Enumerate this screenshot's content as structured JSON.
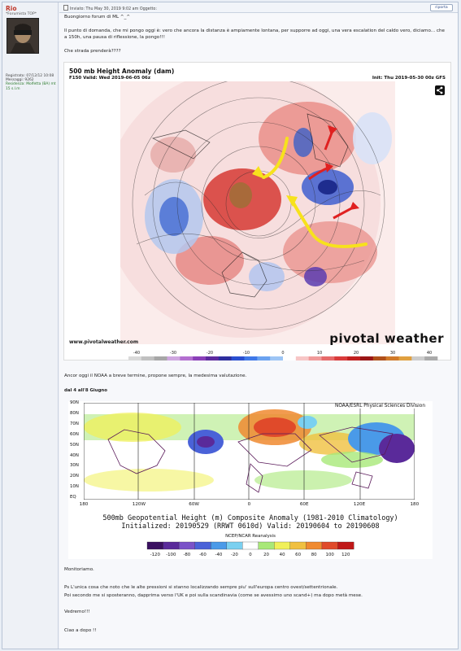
{
  "user": {
    "name": "Rio",
    "rank": "*Forumista TOP*",
    "registered": "Registrato: 07/12/12 10:08",
    "messages": "Messaggi: 9262",
    "residence": "Residenza: Molfetta (BA) mt 15 s.l.m"
  },
  "post": {
    "meta": "Inviato: Thu May 30, 2019 9:02 am    Oggetto:",
    "reply_label": "riporta",
    "greeting": "Buongiorno forum di ML ^_^",
    "para1_line1": "Il punto di domanda, che mi pongo oggi è: vero che ancora la distanza è ampiamente lontana, per supporre ad oggi, una vera escalation del caldo vero, diciamo... che",
    "para1_line2": "a 150h, una pausa di riflessione, la pongo!!!",
    "question": "Che strada prenderà????",
    "para2": "Ancor oggi il NOAA a breve termine, propone sempre, la medesima valutazione.",
    "dates": "dal 4 all'8 Giugno",
    "monitor": "Monitoriamo.",
    "ps1": "Ps L'unica cosa che noto che le alte pressioni si stanno localizzando sempre piu' sull'europa centro ovest/settentrionale.",
    "ps2": "Poi secondo me si sposteranno, dapprima verso l'UK e poi sulla scandinavia (come se avessimo uno scand+) ma dopo metà mese.",
    "vedremo": "Vedremo!!!",
    "ciao": "Ciao a dopo !!"
  },
  "map1": {
    "title": "500 mb Height Anomaly (dam)",
    "valid": "F150 Valid: Wed 2019-06-05 06z",
    "init": "Init: Thu 2019-05-30 00z GFS",
    "url": "www.pivotalweather.com",
    "brand": "pivotal weather",
    "colorbar_ticks": [
      "-40",
      "-30",
      "-20",
      "-10",
      "0",
      "10",
      "20",
      "30",
      "40"
    ],
    "colorbar_colors": [
      "#d9d9d9",
      "#c0c0c0",
      "#a7a7a7",
      "#cfa7e0",
      "#b36fd0",
      "#8a3fb8",
      "#5d2a9e",
      "#2e2e9e",
      "#2a4fd0",
      "#3f78e8",
      "#6aa2f0",
      "#9dc5f5",
      "#ffffff",
      "#f7c6c6",
      "#f09a9a",
      "#e66a6a",
      "#d93b3b",
      "#c01f1f",
      "#9a1515",
      "#b0501a",
      "#d07a2a",
      "#e0a040",
      "#ccc",
      "#aaa"
    ]
  },
  "map2": {
    "source": "NOAA/ESRL Physical Sciences Division",
    "yticks": [
      "90N",
      "80N",
      "70N",
      "60N",
      "50N",
      "40N",
      "30N",
      "20N",
      "10N",
      "EQ"
    ],
    "xticks": [
      "180",
      "120W",
      "60W",
      "0",
      "60E",
      "120E",
      "180"
    ],
    "caption1": "500mb Geopotential Height (m) Composite Anomaly (1981-2010 Climatology)",
    "caption2": "Initialized: 20190529 (RRWT 0610d) Valid: 20190604 to 20190608",
    "reanalysis": "NCEP/NCAR Reanalysis",
    "colorbar_ticks": [
      "-120",
      "-100",
      "-80",
      "-60",
      "-40",
      "-20",
      "0",
      "20",
      "40",
      "60",
      "80",
      "100",
      "120"
    ],
    "colorbar_colors": [
      "#3a1060",
      "#5a2a9a",
      "#7a52c8",
      "#4a62d8",
      "#4a9ae8",
      "#7ad0f0",
      "#ffffff",
      "#a8e878",
      "#f0f05a",
      "#f0c040",
      "#f08a30",
      "#e04a2a",
      "#c01818"
    ]
  }
}
